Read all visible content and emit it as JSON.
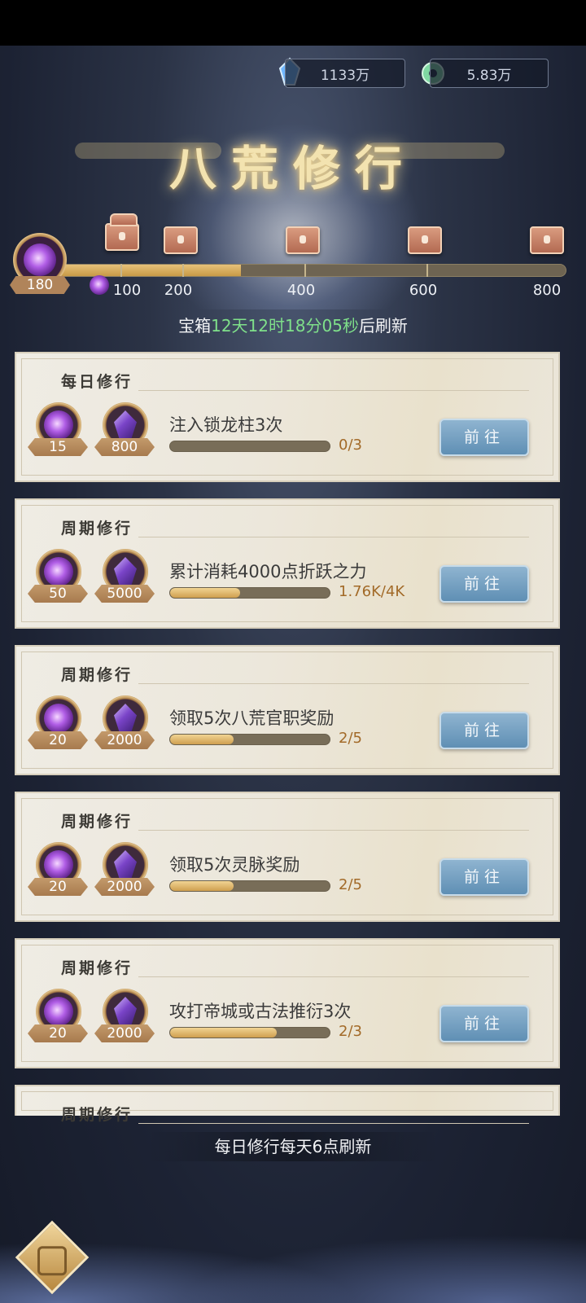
{
  "resources": [
    {
      "icon": "blue-crystal-icon",
      "value": "1133万"
    },
    {
      "icon": "jade-coin-icon",
      "value": "5.83万"
    }
  ],
  "title": "八荒修行",
  "progress": {
    "current": "180",
    "fill_fraction": 0.36,
    "milestones": [
      {
        "label": "100",
        "reward": "opened-chest-icon"
      },
      {
        "label": "200",
        "reward": "chest-icon"
      },
      {
        "label": "400",
        "reward": "chest-icon"
      },
      {
        "label": "600",
        "reward": "chest-icon"
      },
      {
        "label": "800",
        "reward": "chest-icon"
      }
    ]
  },
  "refresh": {
    "prefix": "宝箱",
    "countdown": "12天12时18分05秒",
    "suffix": "后刷新"
  },
  "tasks": [
    {
      "category": "每日修行",
      "reward_orb": "15",
      "reward_crystal": "800",
      "desc": "注入锁龙柱3次",
      "progress_text": "0/3",
      "progress": 0.0,
      "button": "前往"
    },
    {
      "category": "周期修行",
      "reward_orb": "50",
      "reward_crystal": "5000",
      "desc": "累计消耗4000点折跃之力",
      "progress_text": "1.76K/4K",
      "progress": 0.44,
      "button": "前往"
    },
    {
      "category": "周期修行",
      "reward_orb": "20",
      "reward_crystal": "2000",
      "desc": "领取5次八荒官职奖励",
      "progress_text": "2/5",
      "progress": 0.4,
      "button": "前往"
    },
    {
      "category": "周期修行",
      "reward_orb": "20",
      "reward_crystal": "2000",
      "desc": "领取5次灵脉奖励",
      "progress_text": "2/5",
      "progress": 0.4,
      "button": "前往"
    },
    {
      "category": "周期修行",
      "reward_orb": "20",
      "reward_crystal": "2000",
      "desc": "攻打帝城或古法推衍3次",
      "progress_text": "2/3",
      "progress": 0.667,
      "button": "前往"
    },
    {
      "category": "周期修行"
    }
  ],
  "footer_note": "每日修行每天6点刷新",
  "back_icon": "back-diamond-icon"
}
